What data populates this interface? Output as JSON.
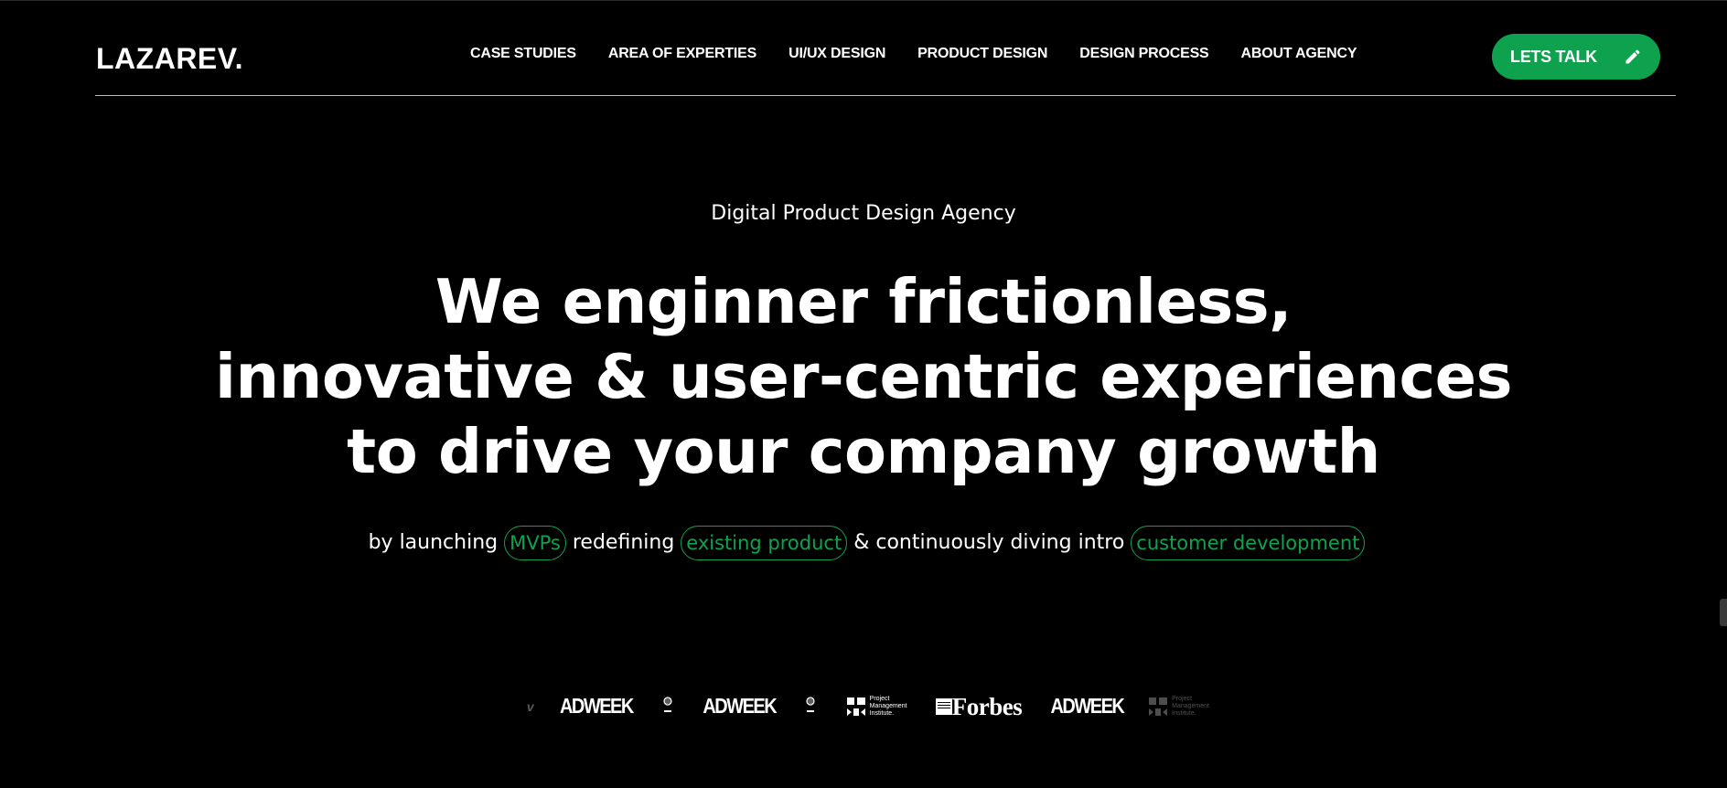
{
  "header": {
    "logo": "LAZAREV.",
    "nav": [
      "CASE STUDIES",
      "AREA OF EXPERTIES",
      "UI/UX DESIGN",
      "PRODUCT DESIGN",
      "DESIGN PROCESS",
      "ABOUT AGENCY"
    ],
    "cta_label": "LETS TALK",
    "cta_icon": "pencil-icon"
  },
  "hero": {
    "eyebrow": "Digital Product Design Agency",
    "headline": [
      "We enginner frictionless,",
      "innovative & user-centric experiences",
      "to drive your company growth"
    ],
    "subline": {
      "t1": "by launching",
      "p1": "MVPs",
      "t2": "redefining",
      "p2": "existing product",
      "t3": "& continuously diving intro",
      "p3": "customer development"
    }
  },
  "logos": {
    "adweek": "ADWEEK",
    "forbes": "Forbes",
    "pmi_line1": "Project",
    "pmi_line2": "Management",
    "pmi_line3": "Institute."
  },
  "colors": {
    "background": "#000000",
    "accent": "#0ea24f",
    "text": "#ffffff"
  }
}
